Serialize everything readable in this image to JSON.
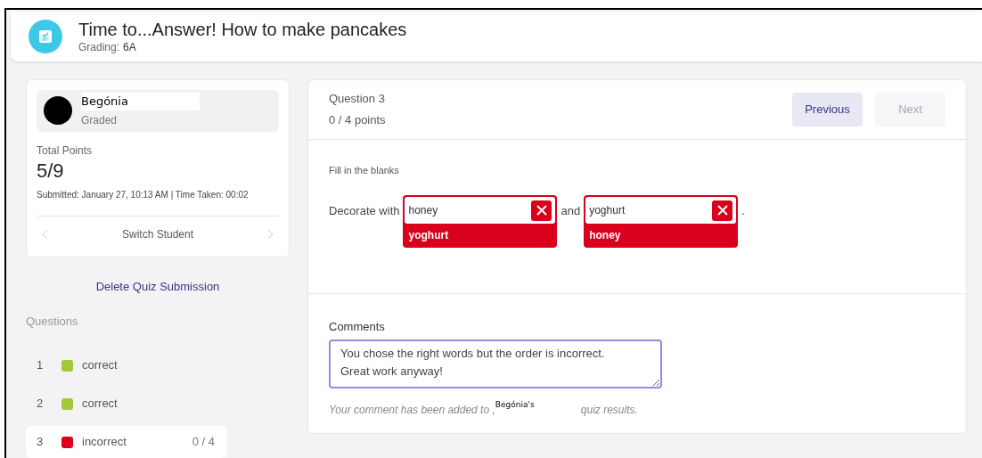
{
  "header": {
    "title": "Time to...Answer! How to make pancakes",
    "grading_label": "Grading:",
    "grading_value": "6A"
  },
  "student": {
    "name": "Begónia",
    "status": "Graded",
    "total_label": "Total Points",
    "total": "5/9",
    "submitted": "Submitted: January 27, 10:13 AM | Time Taken: 00:02",
    "switch_label": "Switch Student"
  },
  "delete_link": "Delete Quiz Submission",
  "questions_heading": "Questions",
  "questions": [
    {
      "number": "1",
      "status": "correct",
      "color": "#a4c639",
      "selected": false
    },
    {
      "number": "2",
      "status": "correct",
      "color": "#a4c639",
      "selected": false
    },
    {
      "number": "3",
      "status": "incorrect",
      "color": "#d9001b",
      "points": "0 / 4",
      "selected": true
    }
  ],
  "question": {
    "title": "Question 3",
    "points": "0 / 4 points",
    "previous": {
      "label": "Previous",
      "disabled": false
    },
    "next": {
      "label": "Next",
      "disabled": true
    },
    "type": "Fill in the blanks",
    "parts": [
      {
        "kind": "text",
        "text": "Decorate with"
      },
      {
        "kind": "blank",
        "answer": "honey",
        "correct_answer": "yoghurt",
        "correct": false
      },
      {
        "kind": "text",
        "text": "and"
      },
      {
        "kind": "blank",
        "answer": "yoghurt",
        "correct_answer": "honey",
        "correct": false
      },
      {
        "kind": "text",
        "text": "."
      }
    ]
  },
  "comments": {
    "label": "Comments",
    "value": "You chose the right words but the order is incorrect.\nGreat work anyway!",
    "hint_before": "Your comment has been added to ,",
    "hint_name": "Begónia's",
    "hint_after": "quiz results."
  }
}
